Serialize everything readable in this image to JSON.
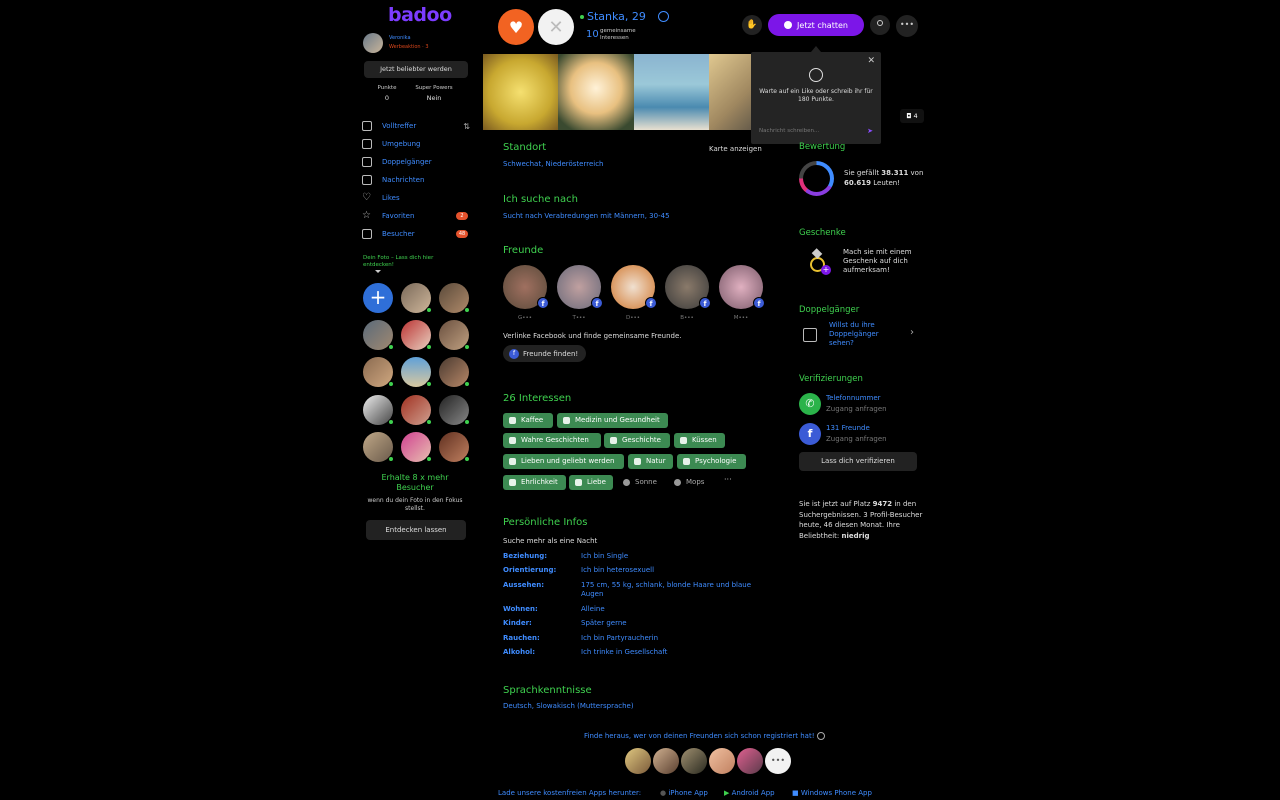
{
  "sidebar": {
    "logo": "badoo",
    "me": {
      "name": "Veronika",
      "status": "Werbeaktion · 3"
    },
    "popular_button": "Jetzt beliebter werden",
    "stats": [
      {
        "label": "Punkte",
        "value": "0"
      },
      {
        "label": "Super Powers",
        "value": "Nein"
      }
    ],
    "nav": [
      {
        "label": "Volltreffer",
        "icon": "cards-icon"
      },
      {
        "label": "Umgebung",
        "icon": "location-icon"
      },
      {
        "label": "Doppelgänger",
        "icon": "lookalike-icon"
      },
      {
        "label": "Nachrichten",
        "icon": "chat-bubble-icon"
      },
      {
        "label": "Likes",
        "icon": "heart-icon"
      },
      {
        "label": "Favoriten",
        "icon": "star-icon",
        "badge": "2"
      },
      {
        "label": "Besucher",
        "icon": "eye-icon",
        "badge": "48"
      }
    ],
    "foto_hint": "Dein Foto – Lass dich hier entdecken!",
    "boost_title": "Erhalte 8 x mehr Besucher",
    "boost_text": "wenn du dein Foto in den Fokus stellst.",
    "discover_button": "Entdecken lassen"
  },
  "header": {
    "profile_name": "Stanka, 29",
    "common_count": "10",
    "common_label": "gemeinsame Interessen",
    "chat_button": "Jetzt chatten"
  },
  "photos": {
    "count": "4"
  },
  "popup": {
    "text": "Warte auf ein Like oder schreib ihr für 180 Punkte.",
    "input_placeholder": "Nachricht schreiben..."
  },
  "profile": {
    "location": {
      "title": "Standort",
      "value": "Schwechat, Niederösterreich",
      "map_link": "Karte anzeigen"
    },
    "looking_for": {
      "title": "Ich suche nach",
      "value": "Sucht nach Verabredungen mit Männern, 30-45"
    },
    "friends": {
      "title": "Freunde",
      "names": [
        "G•••",
        "T•••",
        "D•••",
        "B•••",
        "M•••"
      ],
      "text": "Verlinke Facebook und finde gemeinsame Freunde.",
      "button": "Freunde finden!"
    },
    "interests": {
      "title": "26 Interessen",
      "items": [
        "Kaffee",
        "Medizin und Gesundheit",
        "Wahre Geschichten",
        "Geschichte",
        "Küssen",
        "Lieben und geliebt werden",
        "Natur",
        "Psychologie",
        "Ehrlichkeit",
        "Liebe",
        "Sonne",
        "Mops",
        "···"
      ]
    },
    "personal": {
      "title": "Persönliche Infos",
      "intro": "Suche mehr als eine Nacht",
      "rows": [
        {
          "label": "Beziehung:",
          "value": "Ich bin Single"
        },
        {
          "label": "Orientierung:",
          "value": "Ich bin heterosexuell"
        },
        {
          "label": "Aussehen:",
          "value": "175 cm, 55 kg, schlank, blonde Haare und blaue Augen"
        },
        {
          "label": "Wohnen:",
          "value": "Alleine"
        },
        {
          "label": "Kinder:",
          "value": "Später gerne"
        },
        {
          "label": "Rauchen:",
          "value": "Ich bin Partyraucherin"
        },
        {
          "label": "Alkohol:",
          "value": "Ich trinke in Gesellschaft"
        }
      ]
    },
    "languages": {
      "title": "Sprachkenntnisse",
      "value": "Deutsch, Slowakisch (Muttersprache)"
    }
  },
  "footer": {
    "find_out": "Finde heraus, wer von deinen Freunden sich schon registriert hat!",
    "more": "•••",
    "apps_lead": "Lade unsere kostenfreien Apps herunter:",
    "apps": [
      "iPhone App",
      "Android App",
      "Windows Phone App"
    ]
  },
  "right": {
    "rating": {
      "title": "Bewertung",
      "text_pre": "Sie gefällt ",
      "liked": "38.311",
      "text_mid": " von ",
      "total": "60.619",
      "text_post": " Leuten!"
    },
    "gifts": {
      "title": "Geschenke",
      "text": "Mach sie mit einem Geschenk auf dich aufmerksam!"
    },
    "doppel": {
      "title": "Doppelgänger",
      "text": "Willst du ihre Doppelgänger sehen?"
    },
    "verify": {
      "title": "Verifizierungen",
      "items": [
        {
          "title": "Telefonnummer",
          "sub": "Zugang anfragen"
        },
        {
          "title": "131 Freunde",
          "sub": "Zugang anfragen"
        }
      ],
      "button": "Lass dich verifizieren"
    },
    "rank": {
      "pre": "Sie ist jetzt auf Platz ",
      "place": "9472",
      "mid": " in den Suchergebnissen. 3 Profil-Besucher heute, 46 diesen Monat. Ihre Beliebtheit: ",
      "level": "niedrig"
    }
  },
  "colors": {
    "accent_green": "#3fd14f",
    "link_blue": "#3f8cff",
    "brand_purple": "#7c16e8",
    "like_orange": "#f26322",
    "interest_green": "#3c8a52"
  }
}
